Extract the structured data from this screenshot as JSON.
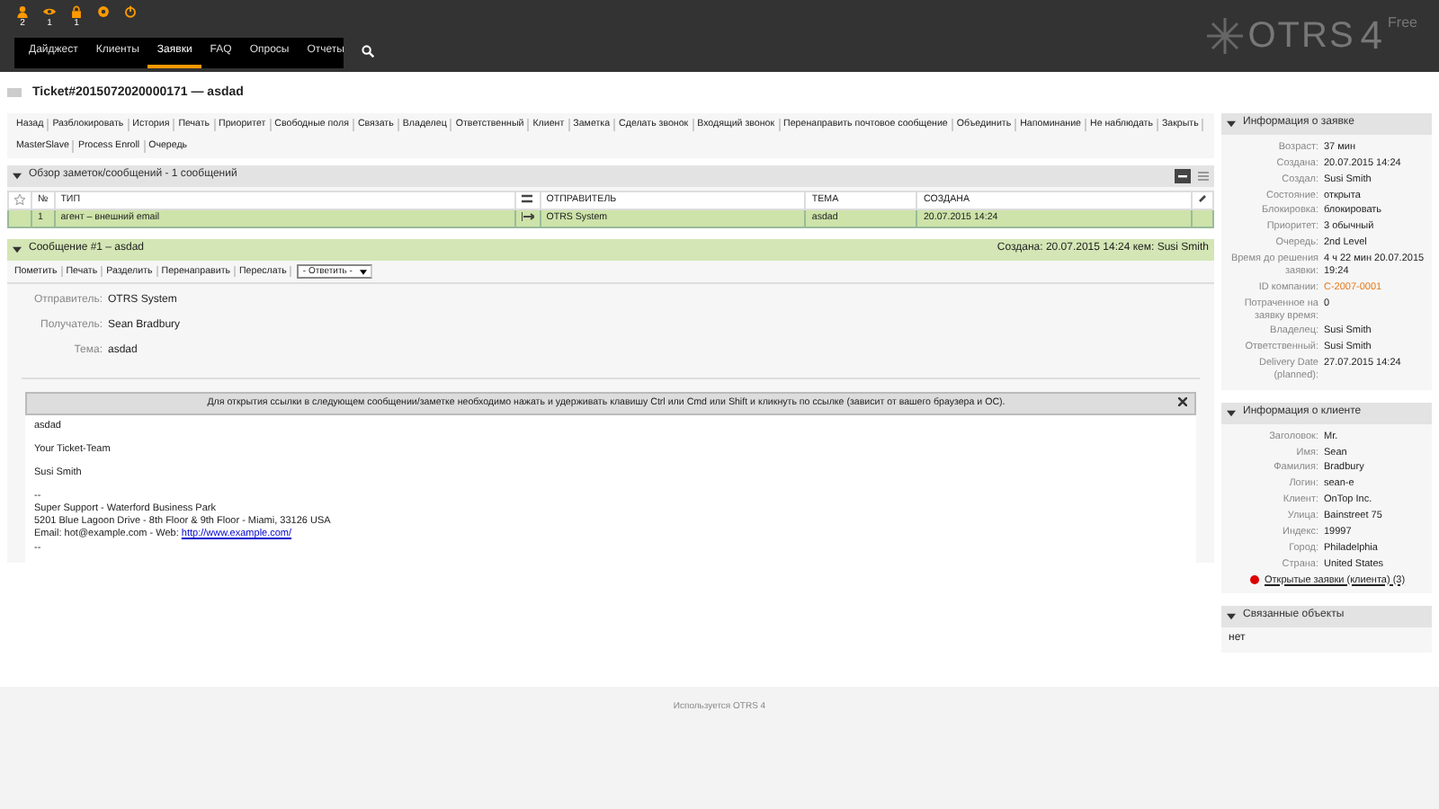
{
  "header": {
    "icons": [
      {
        "kind": "user",
        "count": "2"
      },
      {
        "kind": "eye",
        "count": "1"
      },
      {
        "kind": "lock",
        "count": "1"
      },
      {
        "kind": "gear"
      },
      {
        "kind": "power"
      }
    ],
    "nav": [
      {
        "label": "Дайджест",
        "selected": false
      },
      {
        "label": "Клиенты",
        "selected": false
      },
      {
        "label": "Заявки",
        "selected": true
      },
      {
        "label": "FAQ",
        "selected": false
      },
      {
        "label": "Опросы",
        "selected": false
      },
      {
        "label": "Отчеты",
        "selected": false
      }
    ],
    "logo": {
      "name": "OTRS",
      "version": "4",
      "edition": "Free"
    }
  },
  "title": "Ticket#2015072020000171 — asdad",
  "actions": [
    "Назад",
    "Разблокировать",
    "История",
    "Печать",
    "Приоритет",
    "Свободные поля",
    "Связать",
    "Владелец",
    "Ответственный",
    "Клиент",
    "Заметка",
    "Сделать звонок",
    "Входящий звонок",
    "Перенаправить почтовое сообщение",
    "Объединить",
    "Напоминание",
    "Не наблюдать",
    "Закрыть",
    "MasterSlave",
    "Process Enroll",
    "Очередь"
  ],
  "articles": {
    "title": "Обзор заметок/сообщений - 1 сообщений",
    "columns": [
      "№",
      "ТИП",
      "ОТПРАВИТЕЛЬ",
      "ТЕМА",
      "СОЗДАНА"
    ],
    "rows": [
      {
        "number": "1",
        "type": "агент – внешний email",
        "sender": "OTRS System",
        "subject": "asdad",
        "created": "20.07.2015 14:24",
        "selected": true
      }
    ]
  },
  "message": {
    "title": "Сообщение #1 – asdad",
    "created": "Создана: 20.07.2015 14:24 кем: Susi Smith",
    "actions": [
      "Пометить",
      "Печать",
      "Разделить",
      "Перенаправить",
      "Переслать"
    ],
    "reply_select": "- Ответить -",
    "fields": [
      {
        "label": "Отправитель:",
        "value": "OTRS System"
      },
      {
        "label": "Получатель:",
        "value": "Sean Bradbury"
      },
      {
        "label": "Тема:",
        "value": "asdad"
      }
    ],
    "notice": "Для открытия ссылки в следующем сообщении/заметке необходимо нажать и удерживать клавишу Ctrl или Cmd или Shift и кликнуть по ссылке (зависит от вашего браузера и ОС).",
    "body": [
      "asdad",
      "Your Ticket-Team",
      "Susi Smith"
    ],
    "signature": [
      "--",
      "Super Support - Waterford Business Park",
      "5201 Blue Lagoon Drive - 8th Floor & 9th Floor - Miami, 33126 USA"
    ],
    "contact": {
      "text": "Email: hot@example.com - Web:",
      "link": "http://www.example.com/"
    },
    "signature_end": "--"
  },
  "sidebar": [
    {
      "title": "Информация о заявке",
      "rows": [
        {
          "label": "Возраст:",
          "value": "37 мин"
        },
        {
          "label": "Создана:",
          "value": "20.07.2015 14:24"
        },
        {
          "label": "Создал:",
          "value": "Susi Smith"
        },
        {
          "label": "Состояние:",
          "value": "открыта"
        },
        {
          "label": "Блокировка:",
          "value": "блокировать"
        },
        {
          "label": "Приоритет:",
          "value": "3 обычный"
        },
        {
          "label": "Очередь:",
          "value": "2nd Level"
        },
        {
          "label": "Время до решения заявки:",
          "value": "4 ч 22 мин 20.07.2015 19:24"
        },
        {
          "label": "ID компании:",
          "value": "C-2007-0001",
          "kind": "link"
        },
        {
          "label": "Потраченное на заявку время:",
          "value": "0"
        },
        {
          "label": "Владелец:",
          "value": "Susi Smith"
        },
        {
          "label": "Ответственный:",
          "value": "Susi Smith"
        },
        {
          "label": "Delivery Date (planned):",
          "value": "27.07.2015 14:24"
        }
      ]
    },
    {
      "title": "Информация о клиенте",
      "rows": [
        {
          "label": "Заголовок:",
          "value": "Mr."
        },
        {
          "label": "Имя:",
          "value": "Sean"
        },
        {
          "label": "Фамилия:",
          "value": "Bradbury"
        },
        {
          "label": "Логин:",
          "value": "sean-e"
        },
        {
          "label": "Клиент:",
          "value": "OnTop Inc."
        },
        {
          "label": "Улица:",
          "value": "Bainstreet 75"
        },
        {
          "label": "Индекс:",
          "value": "19997"
        },
        {
          "label": "Город:",
          "value": "Philadelphia"
        },
        {
          "label": "Страна:",
          "value": "United States"
        }
      ],
      "link": "Открытые заявки (клиента) (3)"
    },
    {
      "title": "Связанные объекты",
      "text": "нет"
    }
  ],
  "footer": "Используется OTRS 4"
}
